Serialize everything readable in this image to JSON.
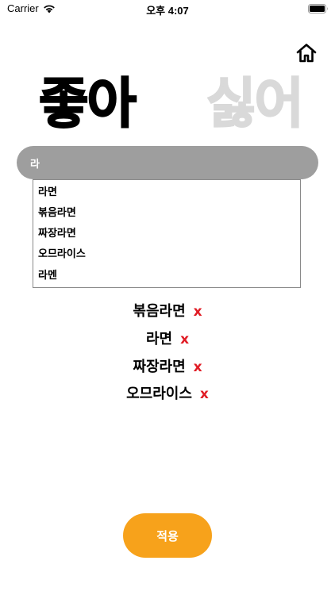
{
  "status_bar": {
    "carrier": "Carrier",
    "time": "오후 4:07"
  },
  "tabs": {
    "like": "좋아",
    "dislike": "싫어"
  },
  "search": {
    "value": "라",
    "placeholder": ""
  },
  "suggestions": [
    "라면",
    "볶음라면",
    "짜장라면",
    "오므라이스",
    "라멘"
  ],
  "selected": [
    "볶음라면",
    "라면",
    "짜장라면",
    "오므라이스"
  ],
  "remove_label": "x",
  "apply_label": "적용",
  "colors": {
    "accent": "#f7a21b",
    "remove": "#e01b24",
    "search_bg": "#9e9e9e",
    "inactive_tab": "#d9d9d9"
  },
  "icons": {
    "home": "home-icon",
    "wifi": "wifi-icon",
    "battery": "battery-icon"
  }
}
